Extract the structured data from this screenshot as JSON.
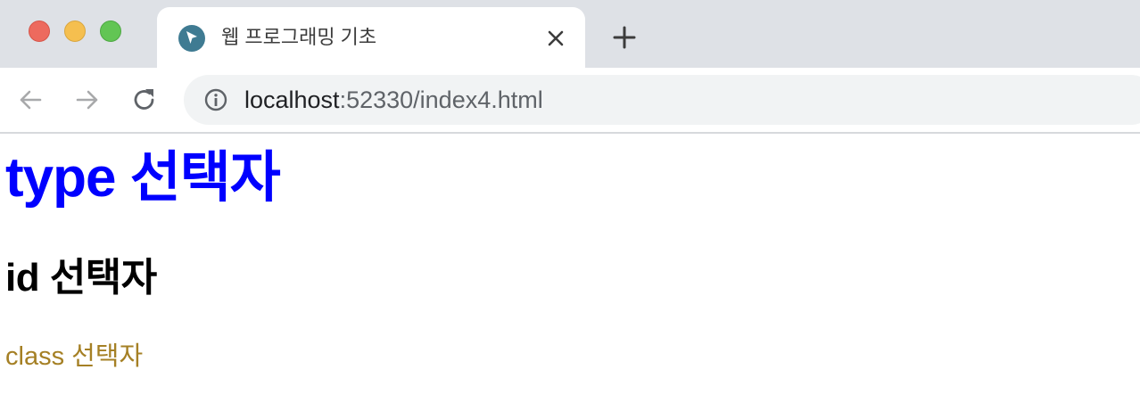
{
  "browser": {
    "tab": {
      "title": "웹 프로그래밍 기초",
      "favicon": "cursor-arrow-icon"
    },
    "address_bar": {
      "host": "localhost",
      "path": ":52330/index4.html"
    },
    "colors": {
      "close": "#ed6a5e",
      "minimize": "#f5bf4f",
      "maximize": "#62c554"
    }
  },
  "page": {
    "h1": "type 선택자",
    "h2": "id 선택자",
    "p": "class 선택자",
    "colors": {
      "h1": "#0000ff",
      "h2": "#000000",
      "p": "#a58025"
    }
  }
}
